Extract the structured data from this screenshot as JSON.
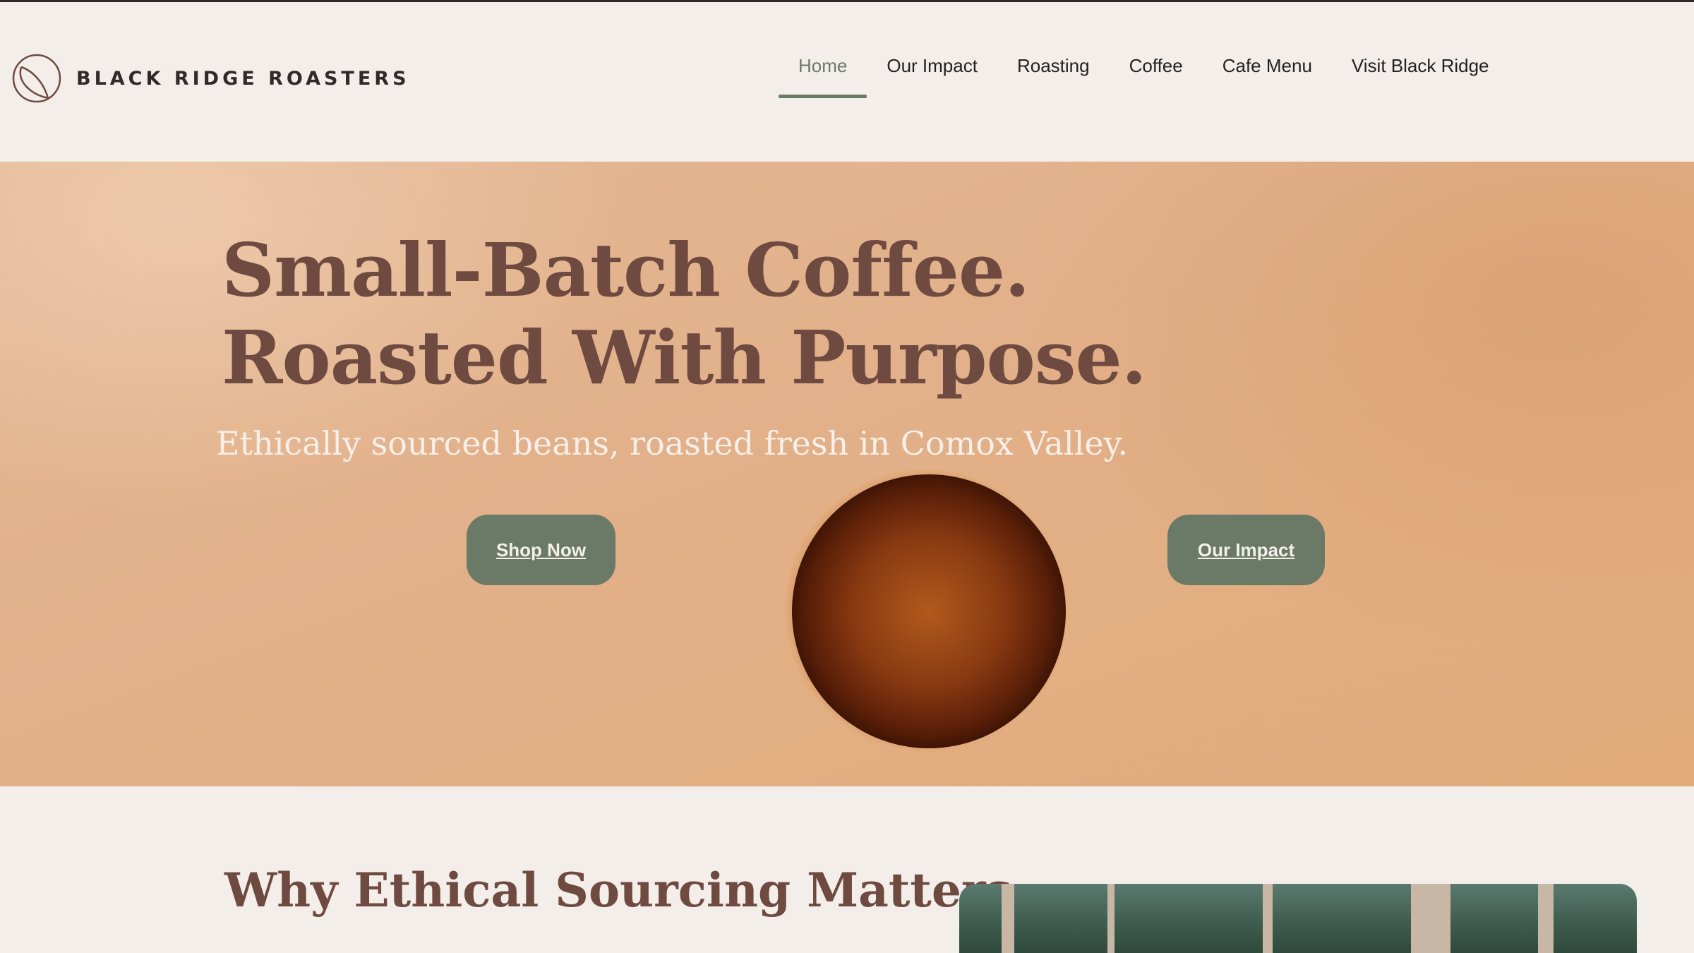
{
  "brand": {
    "name": "BLACK RIDGE ROASTERS",
    "logo_icon": "coffee-bean-icon"
  },
  "nav": {
    "items": [
      {
        "label": "Home",
        "active": true
      },
      {
        "label": "Our Impact",
        "active": false
      },
      {
        "label": "Roasting",
        "active": false
      },
      {
        "label": "Coffee",
        "active": false
      },
      {
        "label": "Cafe Menu",
        "active": false
      },
      {
        "label": "Visit Black Ridge",
        "active": false
      }
    ]
  },
  "hero": {
    "title_line1": "Small-Batch Coffee.",
    "title_line2": "Roasted With Purpose.",
    "subtitle": "Ethically sourced beans, roasted fresh in Comox Valley.",
    "shop_button": "Shop Now",
    "impact_button": "Our Impact"
  },
  "section": {
    "title": "Why Ethical Sourcing Matters"
  },
  "colors": {
    "accent": "#6b7a67",
    "heading": "#6f4a40",
    "background": "#f3eee9",
    "hero_bg": "#e2b089"
  }
}
